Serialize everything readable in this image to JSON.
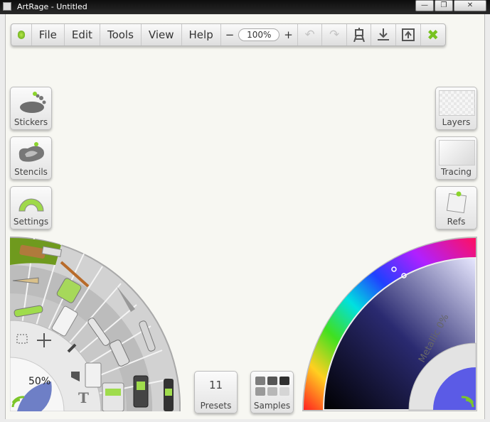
{
  "window": {
    "title": "ArtRage - Untitled",
    "minimize": "—",
    "maximize": "❐",
    "close": "✕"
  },
  "toolbar": {
    "menus": [
      "File",
      "Edit",
      "Tools",
      "View",
      "Help"
    ],
    "zoom_out": "−",
    "zoom_value": "100%",
    "zoom_in": "+",
    "icons": [
      "undo-icon",
      "redo-icon",
      "easel-icon",
      "import-icon",
      "export-icon",
      "close-panels-icon"
    ]
  },
  "left_panel": {
    "stickers_label": "Stickers",
    "stencils_label": "Stencils",
    "settings_label": "Settings"
  },
  "right_panel": {
    "layers_label": "Layers",
    "tracing_label": "Tracing",
    "refs_label": "Refs"
  },
  "presets": {
    "count": "11",
    "label": "Presets"
  },
  "samples": {
    "label": "Samples"
  },
  "tool_wheel": {
    "size_value": "50%",
    "text_tool_glyph": "T"
  },
  "color_picker": {
    "metallic_label": "Metallic 0%",
    "selected_hue": "#5b5be6"
  },
  "colors": {
    "accent_green": "#77c21f",
    "canvas_bg": "#f7f7f2"
  }
}
